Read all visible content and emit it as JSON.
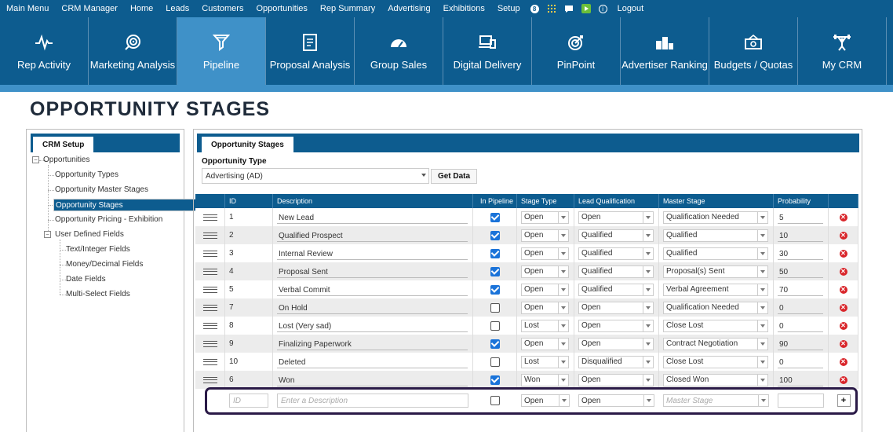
{
  "topmenu": {
    "items": [
      "Main Menu",
      "CRM Manager",
      "Home",
      "Leads",
      "Customers",
      "Opportunities",
      "Rep Summary",
      "Advertising",
      "Exhibitions",
      "Setup"
    ],
    "badge": "8",
    "logout": "Logout"
  },
  "tiles": [
    {
      "label": "Rep Activity",
      "icon": "activity-icon"
    },
    {
      "label": "Marketing Analysis",
      "icon": "target-hand-icon"
    },
    {
      "label": "Pipeline",
      "icon": "funnel-icon"
    },
    {
      "label": "Proposal Analysis",
      "icon": "document-icon"
    },
    {
      "label": "Group Sales",
      "icon": "gauge-icon"
    },
    {
      "label": "Digital Delivery",
      "icon": "devices-icon"
    },
    {
      "label": "PinPoint",
      "icon": "bullseye-icon"
    },
    {
      "label": "Advertiser Ranking",
      "icon": "podium-icon"
    },
    {
      "label": "Budgets / Quotas",
      "icon": "money-icon"
    },
    {
      "label": "My CRM",
      "icon": "weightlifter-icon"
    }
  ],
  "page": {
    "title": "OPPORTUNITY STAGES"
  },
  "left": {
    "tab": "CRM Setup",
    "tree": {
      "root": "Opportunities",
      "children": [
        "Opportunity Types",
        "Opportunity Master Stages",
        "Opportunity Stages",
        "Opportunity Pricing - Exhibition"
      ],
      "udf": "User Defined Fields",
      "udf_children": [
        "Text/Integer Fields",
        "Money/Decimal Fields",
        "Date Fields",
        "Multi-Select Fields"
      ]
    }
  },
  "right": {
    "tab": "Opportunity Stages",
    "type_label": "Opportunity Type",
    "type_value": "Advertising (AD)",
    "get_data": "Get Data"
  },
  "grid": {
    "headers": [
      "ID",
      "Description",
      "In Pipeline",
      "Stage Type",
      "Lead Qualification",
      "Master Stage",
      "Probability"
    ],
    "rows": [
      {
        "id": "1",
        "desc": "New Lead",
        "pipeline": true,
        "stage": "Open",
        "lead": "Open",
        "master": "Qualification Needed",
        "prob": "5"
      },
      {
        "id": "2",
        "desc": "Qualified Prospect",
        "pipeline": true,
        "stage": "Open",
        "lead": "Qualified",
        "master": "Qualified",
        "prob": "10"
      },
      {
        "id": "3",
        "desc": "Internal Review",
        "pipeline": true,
        "stage": "Open",
        "lead": "Qualified",
        "master": "Qualified",
        "prob": "30"
      },
      {
        "id": "4",
        "desc": "Proposal Sent",
        "pipeline": true,
        "stage": "Open",
        "lead": "Qualified",
        "master": "Proposal(s) Sent",
        "prob": "50"
      },
      {
        "id": "5",
        "desc": "Verbal Commit",
        "pipeline": true,
        "stage": "Open",
        "lead": "Qualified",
        "master": "Verbal Agreement",
        "prob": "70"
      },
      {
        "id": "7",
        "desc": "On Hold",
        "pipeline": false,
        "stage": "Open",
        "lead": "Open",
        "master": "Qualification Needed",
        "prob": "0"
      },
      {
        "id": "8",
        "desc": "Lost (Very sad)",
        "pipeline": false,
        "stage": "Lost",
        "lead": "Open",
        "master": "Close Lost",
        "prob": "0"
      },
      {
        "id": "9",
        "desc": "Finalizing Paperwork",
        "pipeline": true,
        "stage": "Open",
        "lead": "Open",
        "master": "Contract Negotiation",
        "prob": "90"
      },
      {
        "id": "10",
        "desc": "Deleted",
        "pipeline": false,
        "stage": "Lost",
        "lead": "Disqualified",
        "master": "Close Lost",
        "prob": "0"
      },
      {
        "id": "6",
        "desc": "Won",
        "pipeline": true,
        "stage": "Won",
        "lead": "Open",
        "master": "Closed Won",
        "prob": "100"
      }
    ],
    "new_row": {
      "id_placeholder": "ID",
      "desc_placeholder": "Enter a Description",
      "stage": "Open",
      "lead": "Open",
      "master_placeholder": "Master Stage",
      "add": "+"
    }
  }
}
